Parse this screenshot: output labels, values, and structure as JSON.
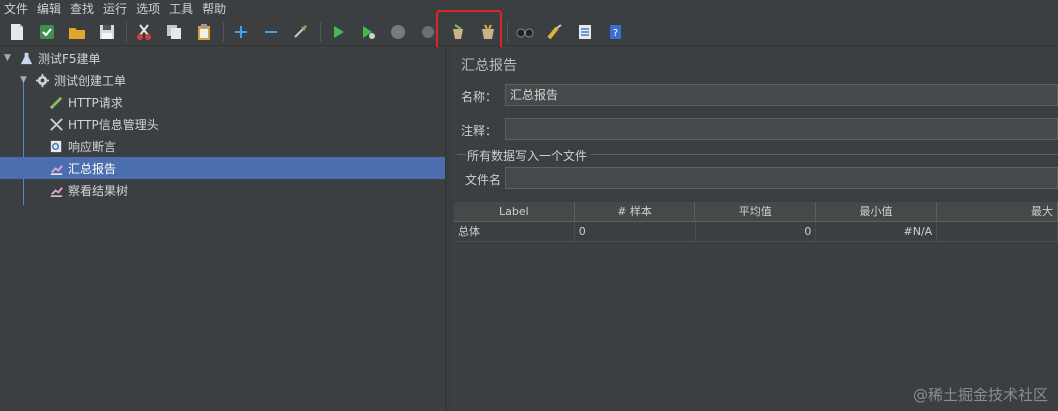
{
  "menu": [
    "文件",
    "编辑",
    "查找",
    "运行",
    "选项",
    "工具",
    "帮助"
  ],
  "toolbar_icons": [
    "new-icon",
    "templates-icon",
    "open-icon",
    "save-icon",
    "cut-icon",
    "copy-icon",
    "paste-icon",
    "expand-icon",
    "collapse-icon",
    "toggle-icon",
    "start-icon",
    "start-no-pause-icon",
    "stop-icon",
    "shutdown-icon",
    "clear-icon",
    "clear-all-icon",
    "search-icon",
    "reset-search-icon",
    "function-helper-icon",
    "help-icon"
  ],
  "tree": {
    "items": [
      {
        "label": "测试F5建单"
      },
      {
        "label": "测试创建工单"
      },
      {
        "label": "HTTP请求"
      },
      {
        "label": "HTTP信息管理头"
      },
      {
        "label": "响应断言"
      },
      {
        "label": "汇总报告"
      },
      {
        "label": "察看结果树"
      }
    ]
  },
  "panel": {
    "title": "汇总报告",
    "name_label": "名称：",
    "name_value": "汇总报告",
    "comment_label": "注释：",
    "comment_value": "",
    "group_title": "所有数据写入一个文件",
    "filename_label": "文件名",
    "filename_value": ""
  },
  "table": {
    "headers": [
      "Label",
      "# 样本",
      "平均值",
      "最小值",
      "最大"
    ],
    "rows": [
      [
        "总体",
        "0",
        "0",
        "#N/A",
        ""
      ]
    ]
  },
  "watermark": "@稀土掘金技术社区",
  "colors": {
    "selection": "#4b6eaf",
    "highlight": "#e02424"
  }
}
